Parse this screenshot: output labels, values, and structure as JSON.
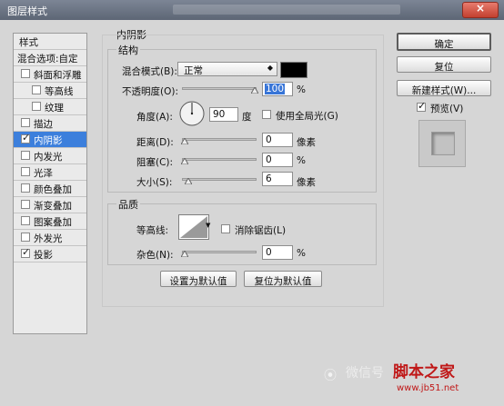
{
  "window": {
    "title": "图层样式",
    "close_label": "×"
  },
  "sidebar": {
    "header": "样式",
    "blend_options": "混合选项:自定",
    "items": [
      {
        "label": "斜面和浮雕",
        "checked": false,
        "indent": false
      },
      {
        "label": "等高线",
        "checked": false,
        "indent": true
      },
      {
        "label": "纹理",
        "checked": false,
        "indent": true
      },
      {
        "label": "描边",
        "checked": false,
        "indent": false
      },
      {
        "label": "内阴影",
        "checked": true,
        "indent": false,
        "selected": true
      },
      {
        "label": "内发光",
        "checked": false,
        "indent": false
      },
      {
        "label": "光泽",
        "checked": false,
        "indent": false
      },
      {
        "label": "颜色叠加",
        "checked": false,
        "indent": false
      },
      {
        "label": "渐变叠加",
        "checked": false,
        "indent": false
      },
      {
        "label": "图案叠加",
        "checked": false,
        "indent": false
      },
      {
        "label": "外发光",
        "checked": false,
        "indent": false
      },
      {
        "label": "投影",
        "checked": true,
        "indent": false
      }
    ]
  },
  "panel": {
    "title": "内阴影",
    "structure": {
      "title": "结构",
      "blend_mode_label": "混合模式(B):",
      "blend_mode_value": "正常",
      "blend_color": "#000000",
      "opacity_label": "不透明度(O):",
      "opacity_value": "100",
      "opacity_unit": "%",
      "angle_label": "角度(A):",
      "angle_value": "90",
      "angle_unit": "度",
      "global_light_label": "使用全局光(G)",
      "global_light_checked": false,
      "distance_label": "距离(D):",
      "distance_value": "0",
      "distance_unit": "像素",
      "choke_label": "阻塞(C):",
      "choke_value": "0",
      "choke_unit": "%",
      "size_label": "大小(S):",
      "size_value": "6",
      "size_unit": "像素"
    },
    "quality": {
      "title": "品质",
      "contour_label": "等高线:",
      "antialias_label": "消除锯齿(L)",
      "antialias_checked": false,
      "noise_label": "杂色(N):",
      "noise_value": "0",
      "noise_unit": "%"
    },
    "buttons": {
      "set_default": "设置为默认值",
      "reset_default": "复位为默认值"
    }
  },
  "actions": {
    "ok": "确定",
    "reset": "复位",
    "new_style": "新建样式(W)...",
    "preview_label": "预览(V)",
    "preview_checked": true
  },
  "watermark": {
    "wechat": "微信号",
    "site_name": "脚本之家",
    "site_url": "www.jb51.net"
  }
}
